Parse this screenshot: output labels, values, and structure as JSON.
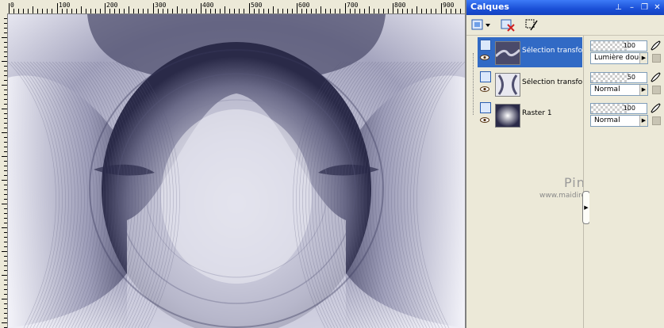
{
  "ruler": {
    "labels": [
      "0",
      "100",
      "200",
      "300",
      "400",
      "500",
      "600",
      "700",
      "800",
      "900"
    ]
  },
  "palette": {
    "title": "Calques",
    "title_buttons": {
      "pin": "⊥",
      "minimize": "–",
      "restore": "❐",
      "close": "✕"
    }
  },
  "layers": [
    {
      "name": "Sélection transformée",
      "opacity": "100",
      "blend_mode": "Lumière douce",
      "selected": true
    },
    {
      "name": "Sélection transformée",
      "opacity": "50",
      "blend_mode": "Normal",
      "selected": false
    },
    {
      "name": "Raster 1",
      "opacity": "100",
      "blend_mode": "Normal",
      "selected": false
    }
  ],
  "watermark": {
    "name": "Pinuccia",
    "url": "www.maidiregrafica.eu"
  },
  "colors": {
    "title_bar": "#1a4fd6",
    "selection": "#316ac5",
    "panel": "#ece9d8",
    "image_dark": "#2a2a48",
    "image_light": "#f2f2f8"
  }
}
